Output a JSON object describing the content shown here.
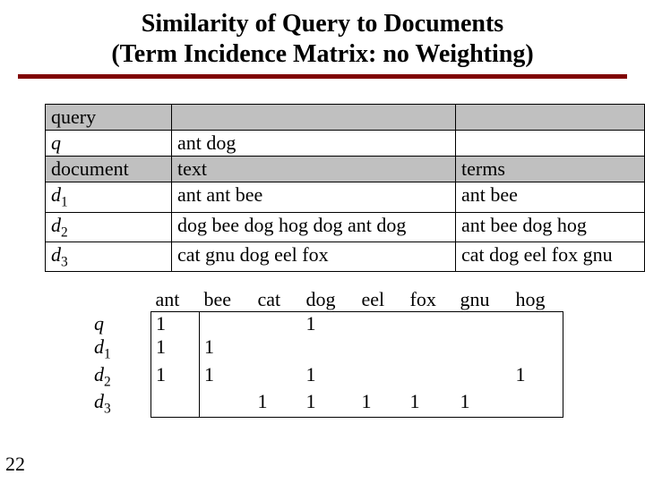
{
  "title_line1": "Similarity of Query to Documents",
  "title_line2": "(Term Incidence Matrix: no Weighting)",
  "page_number": "22",
  "t1": {
    "r0c0": "query",
    "r1c0": "q",
    "r1c1": "ant dog",
    "r2c0": "document",
    "r2c1": "text",
    "r2c2": "terms",
    "r3c0_a": "d",
    "r3c0_b": "1",
    "r3c1": "ant ant bee",
    "r3c2": "ant bee",
    "r4c0_a": "d",
    "r4c0_b": "2",
    "r4c1": "dog bee dog hog dog ant dog",
    "r4c2": "ant bee dog hog",
    "r5c0_a": "d",
    "r5c0_b": "3",
    "r5c1": "cat gnu dog eel fox",
    "r5c2": "cat dog eel fox gnu"
  },
  "t2": {
    "h_ant": "ant",
    "h_bee": "bee",
    "h_cat": "cat",
    "h_dog": "dog",
    "h_eel": "eel",
    "h_fox": "fox",
    "h_gnu": "gnu",
    "h_hog": "hog",
    "r_q": "q",
    "r_d1_a": "d",
    "r_d1_b": "1",
    "r_d2_a": "d",
    "r_d2_b": "2",
    "r_d3_a": "d",
    "r_d3_b": "3",
    "q": {
      "ant": "1",
      "dog": "1"
    },
    "d1": {
      "ant": "1",
      "bee": "1"
    },
    "d2": {
      "ant": "1",
      "bee": "1",
      "dog": "1",
      "hog": "1"
    },
    "d3": {
      "cat": "1",
      "dog": "1",
      "eel": "1",
      "fox": "1",
      "gnu": "1"
    }
  },
  "chart_data": {
    "type": "table",
    "title": "Term Incidence Matrix",
    "columns": [
      "ant",
      "bee",
      "cat",
      "dog",
      "eel",
      "fox",
      "gnu",
      "hog"
    ],
    "rows": [
      "q",
      "d1",
      "d2",
      "d3"
    ],
    "values": [
      [
        1,
        0,
        0,
        1,
        0,
        0,
        0,
        0
      ],
      [
        1,
        1,
        0,
        0,
        0,
        0,
        0,
        0
      ],
      [
        1,
        1,
        0,
        1,
        0,
        0,
        0,
        1
      ],
      [
        0,
        0,
        1,
        1,
        1,
        1,
        1,
        0
      ]
    ]
  }
}
